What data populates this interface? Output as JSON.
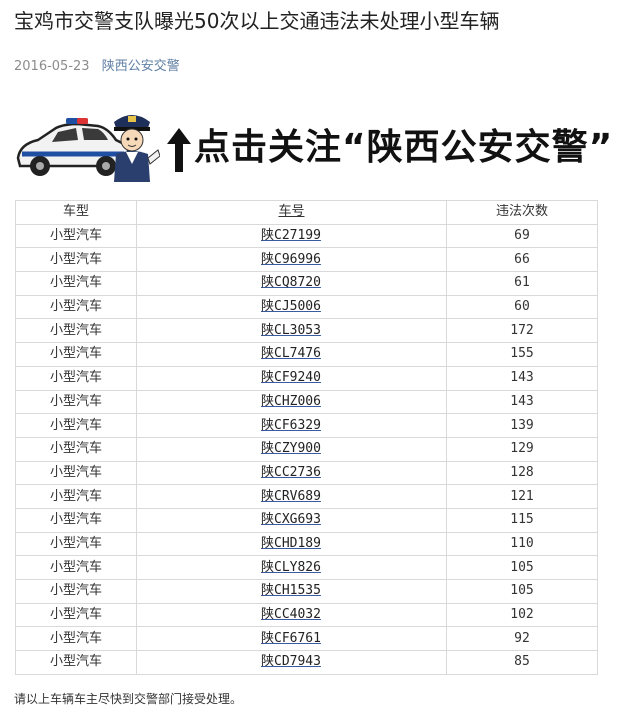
{
  "article": {
    "title": "宝鸡市交警支队曝光50次以上交通违法未处理小型车辆",
    "date": "2016-05-23",
    "account": "陕西公安交警"
  },
  "banner": {
    "text": "点击关注“陕西公安交警”",
    "icons": [
      "police-car-icon",
      "police-officer-icon",
      "up-arrow-icon"
    ]
  },
  "table": {
    "headers": [
      "车型",
      "车号",
      "违法次数"
    ],
    "rows": [
      {
        "type": "小型汽车",
        "plate": "陕C27199",
        "count": "69"
      },
      {
        "type": "小型汽车",
        "plate": "陕C96996",
        "count": "66"
      },
      {
        "type": "小型汽车",
        "plate": "陕CQ8720",
        "count": "61"
      },
      {
        "type": "小型汽车",
        "plate": "陕CJ5006",
        "count": "60"
      },
      {
        "type": "小型汽车",
        "plate": "陕CL3053",
        "count": "172"
      },
      {
        "type": "小型汽车",
        "plate": "陕CL7476",
        "count": "155"
      },
      {
        "type": "小型汽车",
        "plate": "陕CF9240",
        "count": "143"
      },
      {
        "type": "小型汽车",
        "plate": "陕CHZ006",
        "count": "143"
      },
      {
        "type": "小型汽车",
        "plate": "陕CF6329",
        "count": "139"
      },
      {
        "type": "小型汽车",
        "plate": "陕CZY900",
        "count": "129"
      },
      {
        "type": "小型汽车",
        "plate": "陕CC2736",
        "count": "128"
      },
      {
        "type": "小型汽车",
        "plate": "陕CRV689",
        "count": "121"
      },
      {
        "type": "小型汽车",
        "plate": "陕CXG693",
        "count": "115"
      },
      {
        "type": "小型汽车",
        "plate": "陕CHD189",
        "count": "110"
      },
      {
        "type": "小型汽车",
        "plate": "陕CLY826",
        "count": "105"
      },
      {
        "type": "小型汽车",
        "plate": "陕CH1535",
        "count": "105"
      },
      {
        "type": "小型汽车",
        "plate": "陕CC4032",
        "count": "102"
      },
      {
        "type": "小型汽车",
        "plate": "陕CF6761",
        "count": "92"
      },
      {
        "type": "小型汽车",
        "plate": "陕CD7943",
        "count": "85"
      }
    ]
  },
  "footer": {
    "note": "请以上车辆车主尽快到交警部门接受处理。"
  },
  "colors": {
    "account_link": "#607fa6",
    "date_gray": "#8c8c8c",
    "table_border": "#d9d9d9",
    "police_blue": "#1e4fa3"
  }
}
